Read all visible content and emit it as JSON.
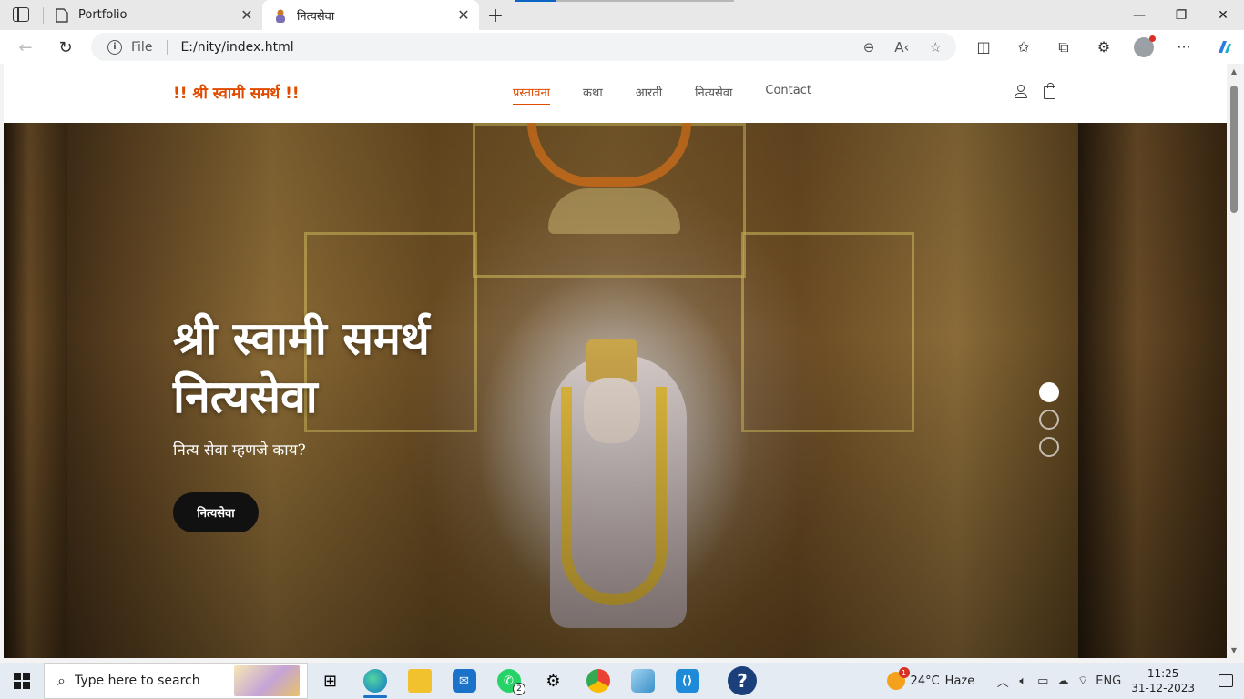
{
  "browser": {
    "tabs": [
      {
        "title": "Portfolio",
        "active": false
      },
      {
        "title": "नित्यसेवा",
        "active": true
      }
    ],
    "address": {
      "scheme_label": "File",
      "url": "E:/nity/index.html"
    },
    "colors": {
      "accent": "#0b63c4"
    }
  },
  "site": {
    "brand": "!! श्री स्वामी समर्थ !!",
    "nav": [
      "प्रस्तावना",
      "कथा",
      "आरती",
      "नित्यसेवा",
      "Contact"
    ],
    "active_nav": "प्रस्तावना",
    "hero": {
      "title_line1": "श्री स्वामी समर्थ",
      "title_line2": "नित्यसेवा",
      "subtitle": "नित्य सेवा म्हणजे काय?",
      "button": "नित्यसेवा"
    },
    "carousel": {
      "slides": 3,
      "active": 1
    },
    "colors": {
      "brand": "#e04b00",
      "button": "#111111"
    }
  },
  "taskbar": {
    "search_placeholder": "Type here to search",
    "whatsapp_badge": "2",
    "weather": {
      "temp": "24°C",
      "condition": "Haze",
      "alert_count": "1"
    },
    "language": "ENG",
    "time": "11:25",
    "date": "31-12-2023"
  }
}
